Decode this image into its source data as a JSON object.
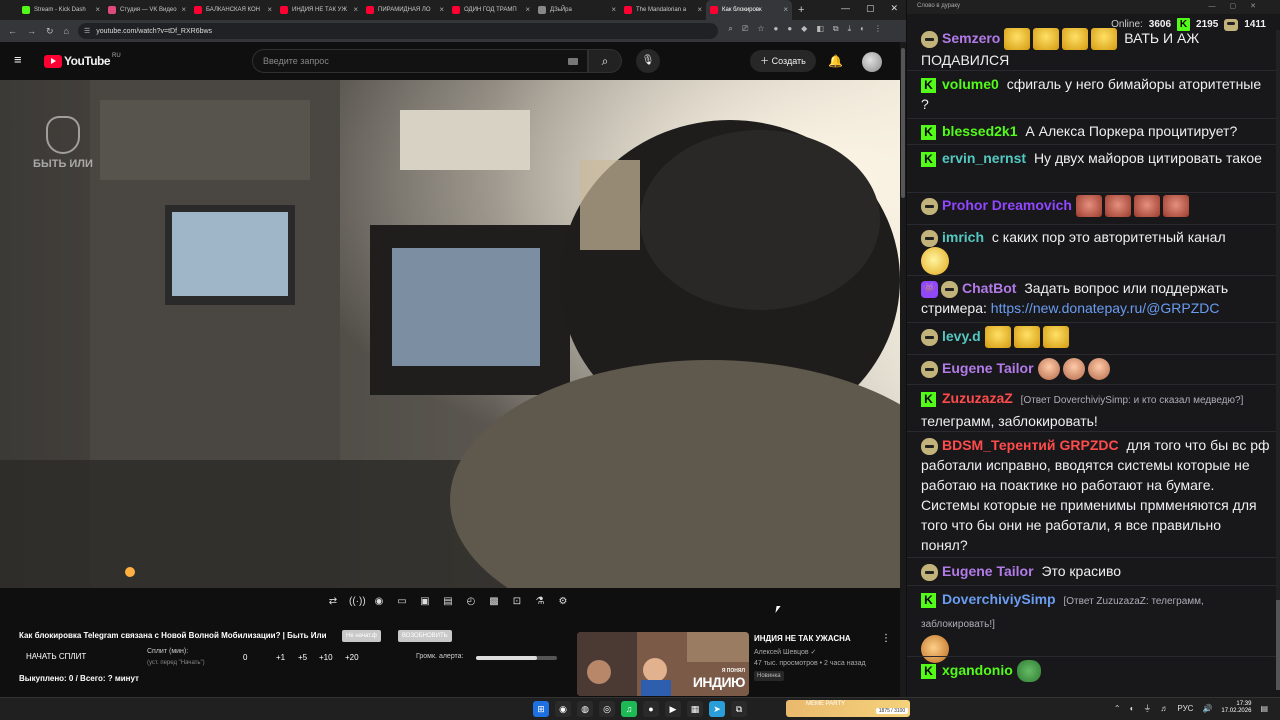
{
  "browser": {
    "tabs": [
      {
        "label": "Stream - Kick Dash",
        "color": "#53fc18"
      },
      {
        "label": "Студия — VK Видео",
        "color": "#e04a7a"
      },
      {
        "label": "БАЛКАНСКАЯ КОН",
        "color": "#ff0033"
      },
      {
        "label": "ИНДИЯ НЕ ТАК УЖ",
        "color": "#ff0033"
      },
      {
        "label": "ПИРАМИДНАЯ ЛО",
        "color": "#ff0033"
      },
      {
        "label": "ОДИН ГОД ТРАМП",
        "color": "#ff0033"
      },
      {
        "label": "ДЗьЙра",
        "color": "#888888"
      },
      {
        "label": "The Mandalorian a",
        "color": "#ff0033"
      },
      {
        "label": "Как блокировк",
        "color": "#ff0033"
      }
    ],
    "url": "youtube.com/watch?v=tDf_RXR6bws"
  },
  "youtube": {
    "logo_text": "YouTube",
    "country": "RU",
    "search_placeholder": "Введите запрос",
    "create_label": "Создать",
    "watermark": "БЫТЬ ИЛИ",
    "video_title": "Как блокировка Telegram связана с Новой Волной Мобилизации? | Быть Или",
    "tag1": "Не начат.ф",
    "tag2": "ВОЗОБНОВИТЬ",
    "split_button": "НАЧАТЬ СПЛИТ",
    "split_label": "Сплит (мин):",
    "split_hint": "(уст. перед \"Начать\")",
    "split_values": [
      "0",
      "+1",
      "+5",
      "+10",
      "+20"
    ],
    "alert_label": "Громк. алерта:",
    "alert_volume": 0.75,
    "paid_text": "Выкуплено: 0 / Всего: ? минут",
    "recommendation": {
      "title": "ИНДИЯ НЕ ТАК УЖАСНА",
      "channel": "Алексей Шевцов ✓",
      "meta": "47 тыс. просмотров • 2 часа назад",
      "badge": "Новинка",
      "thumb_small": "Я ПОНЯЛ",
      "thumb_big": "ИНДИЮ"
    },
    "controls": [
      "⇄",
      "((·))",
      "◉",
      "▭",
      "▣",
      "▤",
      "◴",
      "▩",
      "⊡",
      "⚗",
      "⚙"
    ]
  },
  "chat": {
    "window_title": "Слово в дураку",
    "online_label": "Online:",
    "online_count": "3606",
    "kick_count": "2195",
    "twitch_count": "1411",
    "messages": [
      {
        "user": "Semzero",
        "color": "#b27be8",
        "text": "ВАТЬ И АЖ ПОДАВИЛСЯ"
      },
      {
        "user": "volume0",
        "color": "#53fc18",
        "text": "сфигаль у него бимайоры аторитетные ?"
      },
      {
        "user": "blessed2k1",
        "color": "#53fc18",
        "text": "А Алекса Поркера процитирует?"
      },
      {
        "user": "ervin_nernst",
        "color": "#53c8c0",
        "text": "Ну двух майоров цитировать такое"
      },
      {
        "user": "Prohor Dreamovich",
        "color": "#9146ff",
        "text": ""
      },
      {
        "user": "imrich",
        "color": "#53c8c0",
        "text": "с каких пор это авторитетный канал"
      },
      {
        "user": "ChatBot",
        "color": "#b27be8",
        "text": "Задать вопрос или поддержать стримера:",
        "link": "https://new.donatepay.ru/@GRPZDC"
      },
      {
        "user": "levy.d",
        "color": "#53c8c0",
        "text": ""
      },
      {
        "user": "Eugene Tailor",
        "color": "#b27be8",
        "text": ""
      },
      {
        "user": "ZuzuzazaZ",
        "color": "#ff4b4b",
        "reply": "[Ответ DoverchiviySimp: и кто сказал медведю?]",
        "text": "телеграмм, заблокировать!"
      },
      {
        "user": "BDSM_Терентий",
        "mention": "GRPZDC",
        "color": "#ff4b4b",
        "text": "для того что бы вс рф работали исправно, вводятся системы которые не работаю на поактике но работают на бумаге. Системы которые не применимы прмменяются для того что бы они не работали, я все правильно понял?"
      },
      {
        "user": "Eugene Tailor",
        "color": "#b27be8",
        "text": "Это красиво"
      },
      {
        "user": "DoverchiviySimp",
        "color": "#6a9cf0",
        "reply": "[Ответ ZuzuzazaZ: телеграмм, заблокировать!]",
        "text": ""
      },
      {
        "user": "xgandonio",
        "color": "#53fc18",
        "text": ""
      }
    ]
  },
  "taskbar": {
    "meme": "MEME PARTY",
    "meme_progress": "1875 / 3100",
    "lang": "РУС",
    "time": "17:39",
    "date": "17.02.2026"
  }
}
